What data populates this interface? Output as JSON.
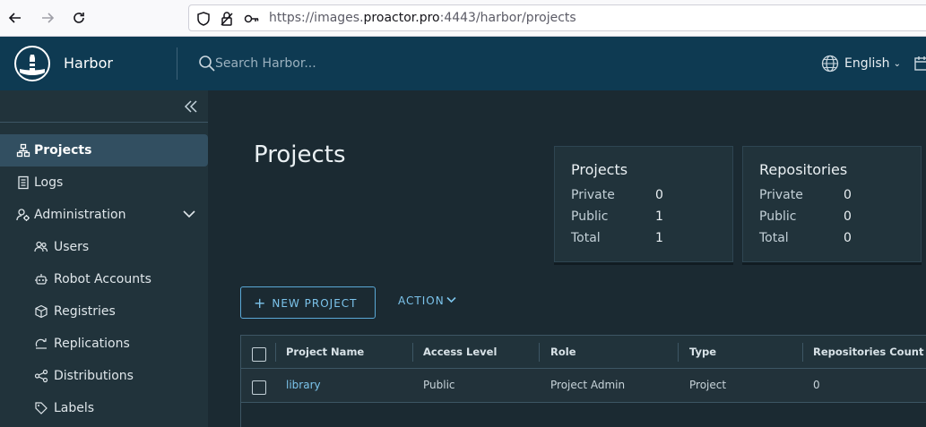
{
  "browser": {
    "url_prefix": "https://images.",
    "url_host": "proactor.pro",
    "url_suffix": ":4443/harbor/projects"
  },
  "header": {
    "brand": "Harbor",
    "search_placeholder": "Search Harbor...",
    "language": "English"
  },
  "sidebar": {
    "items": [
      {
        "label": "Projects",
        "icon": "projects-icon",
        "active": true
      },
      {
        "label": "Logs",
        "icon": "logs-icon"
      },
      {
        "label": "Administration",
        "icon": "admin-icon"
      },
      {
        "label": "Users",
        "icon": "users-icon"
      },
      {
        "label": "Robot Accounts",
        "icon": "robot-icon"
      },
      {
        "label": "Registries",
        "icon": "registries-icon"
      },
      {
        "label": "Replications",
        "icon": "replications-icon"
      },
      {
        "label": "Distributions",
        "icon": "distributions-icon"
      },
      {
        "label": "Labels",
        "icon": "labels-icon"
      }
    ]
  },
  "main": {
    "title": "Projects",
    "projects_card": {
      "title": "Projects",
      "rows": [
        {
          "label": "Private",
          "value": "0"
        },
        {
          "label": "Public",
          "value": "1"
        },
        {
          "label": "Total",
          "value": "1"
        }
      ]
    },
    "repositories_card": {
      "title": "Repositories",
      "rows": [
        {
          "label": "Private",
          "value": "0"
        },
        {
          "label": "Public",
          "value": "0"
        },
        {
          "label": "Total",
          "value": "0"
        }
      ]
    },
    "new_project_label": "NEW PROJECT",
    "action_label": "ACTION"
  },
  "grid": {
    "columns": [
      "Project Name",
      "Access Level",
      "Role",
      "Type",
      "Repositories Count"
    ],
    "rows": [
      {
        "name": "library",
        "access": "Public",
        "role": "Project Admin",
        "type": "Project",
        "repos": "0"
      }
    ]
  },
  "colors": {
    "header_bg": "#0e3a52",
    "sidebar_bg": "#21333b",
    "main_bg": "#1b2a32",
    "accent": "#7cc4ec"
  }
}
